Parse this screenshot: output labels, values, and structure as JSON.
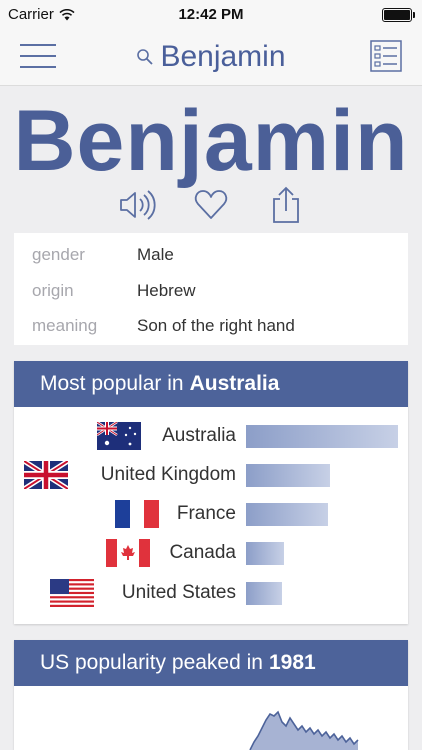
{
  "status_bar": {
    "carrier": "Carrier",
    "time": "12:42 PM"
  },
  "nav": {
    "title": "Benjamin",
    "menu_icon": "hamburger-icon",
    "search_icon": "search-icon",
    "list_icon": "checklist-icon"
  },
  "hero": {
    "name": "Benjamin"
  },
  "actions": [
    {
      "icon": "speaker-icon"
    },
    {
      "icon": "heart-icon"
    },
    {
      "icon": "share-icon"
    }
  ],
  "info": [
    {
      "label": "gender",
      "value": "Male"
    },
    {
      "label": "origin",
      "value": "Hebrew"
    },
    {
      "label": "meaning",
      "value": "Son of the right hand"
    }
  ],
  "popular": {
    "title_prefix": "Most popular in",
    "title_country": "Australia",
    "rows": [
      {
        "country": "Australia",
        "flag": "australia-flag",
        "level": 1.0
      },
      {
        "country": "United Kingdom",
        "flag": "uk-flag",
        "level": 0.55
      },
      {
        "country": "France",
        "flag": "france-flag",
        "level": 0.54
      },
      {
        "country": "Canada",
        "flag": "canada-flag",
        "level": 0.25
      },
      {
        "country": "United States",
        "flag": "us-flag",
        "level": 0.24
      }
    ]
  },
  "peak": {
    "title_prefix": "US popularity peaked in",
    "year": "1981"
  },
  "colors": {
    "accent": "#4d639a",
    "title": "#4b5f97",
    "bar_start": "#8c9ec8",
    "bar_end": "#c7d0e6"
  }
}
